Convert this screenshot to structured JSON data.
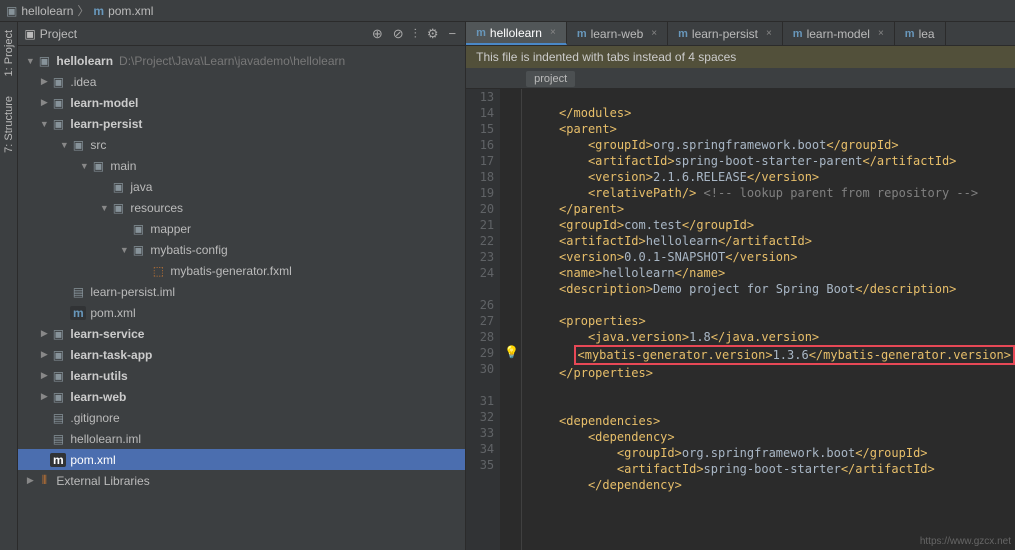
{
  "breadcrumb": {
    "root": "hellolearn",
    "file": "pom.xml"
  },
  "panel": {
    "title": "Project",
    "tool_target": "⊕",
    "tool_compass": "⊘",
    "tool_divide": "⫶",
    "tool_gear": "⚙",
    "tool_collapse": "−"
  },
  "sidebar": {
    "project": "1: Project",
    "structure": "7: Structure"
  },
  "tree": {
    "root": "hellolearn",
    "path": "D:\\Project\\Java\\Learn\\javademo\\hellolearn",
    "idea": ".idea",
    "learn_model": "learn-model",
    "learn_persist": "learn-persist",
    "src": "src",
    "main": "main",
    "java": "java",
    "resources": "resources",
    "mapper": "mapper",
    "mybatis_config": "mybatis-config",
    "mybatis_gen": "mybatis-generator.fxml",
    "learn_persist_iml": "learn-persist.iml",
    "pom_xml": "pom.xml",
    "learn_service": "learn-service",
    "learn_task_app": "learn-task-app",
    "learn_utils": "learn-utils",
    "learn_web": "learn-web",
    "gitignore": ".gitignore",
    "hellolearn_iml": "hellolearn.iml",
    "ext_libs": "External Libraries"
  },
  "tabs": [
    {
      "label": "hellolearn",
      "active": true
    },
    {
      "label": "learn-web",
      "active": false
    },
    {
      "label": "learn-persist",
      "active": false
    },
    {
      "label": "learn-model",
      "active": false
    },
    {
      "label": "lea",
      "active": false
    }
  ],
  "banner": "This file is indented with tabs instead of 4 spaces",
  "crumb": "project",
  "code": {
    "l13": "</modules>",
    "l14_o": "<parent>",
    "l15": "<groupId>",
    "l15_t": "org.springframework.boot",
    "l15_c": "</groupId>",
    "l16": "<artifactId>",
    "l16_t": "spring-boot-starter-parent",
    "l16_c": "</artifactId>",
    "l17": "<version>",
    "l17_t": "2.1.6.RELEASE",
    "l17_c": "</version>",
    "l18": "<relativePath/>",
    "l18_c": " <!-- lookup parent from repository -->",
    "l19": "</parent>",
    "l20": "<groupId>",
    "l20_t": "com.test",
    "l20_c": "</groupId>",
    "l21": "<artifactId>",
    "l21_t": "hellolearn",
    "l21_c": "</artifactId>",
    "l22": "<version>",
    "l22_t": "0.0.1-SNAPSHOT",
    "l22_c": "</version>",
    "l23": "<name>",
    "l23_t": "hellolearn",
    "l23_c": "</name>",
    "l24": "<description>",
    "l24_t": "Demo project for Spring Boot",
    "l24_c": "</description>",
    "l26": "<properties>",
    "l27": "<java.version>",
    "l27_t": "1.8",
    "l27_c": "</java.version>",
    "l28": "<mybatis-generator.version>",
    "l28_t": "1.3.6",
    "l28_c": "</mybatis-generator.version>",
    "l29": "</properties>",
    "l31": "<dependencies>",
    "l32": "<dependency>",
    "l33": "<groupId>",
    "l33_t": "org.springframework.boot",
    "l33_c": "</groupId>",
    "l34": "<artifactId>",
    "l34_t": "spring-boot-starter",
    "l34_c": "</artifactId>",
    "l35": "</dependency>"
  },
  "line_numbers": [
    "13",
    "14",
    "15",
    "16",
    "17",
    "18",
    "19",
    "20",
    "21",
    "22",
    "23",
    "24",
    "",
    "26",
    "27",
    "28",
    "29",
    "30",
    "",
    "31",
    "32",
    "33",
    "34",
    "35"
  ],
  "watermark": "https://www.gzcx.net"
}
